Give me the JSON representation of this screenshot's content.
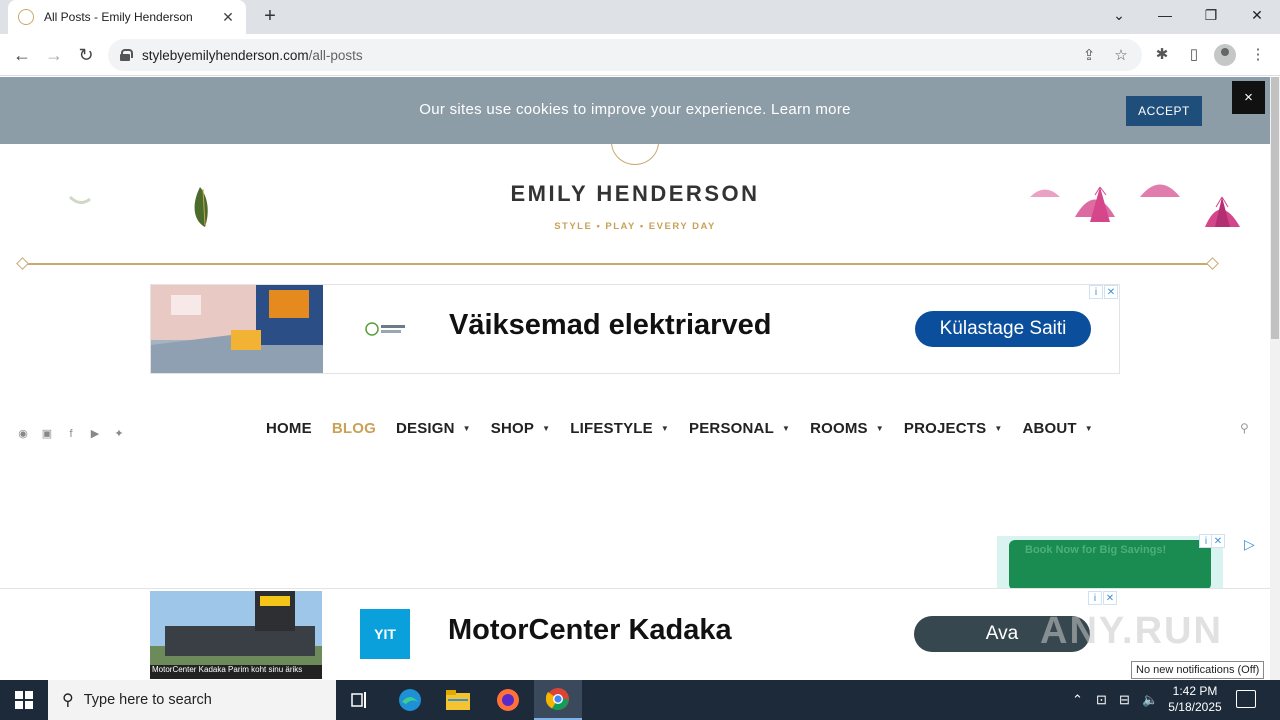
{
  "browser": {
    "tab_title": "All Posts - Emily Henderson",
    "new_tab": "+",
    "url_host": "stylebyemilyhenderson.com",
    "url_path": "/all-posts"
  },
  "cookie_banner": {
    "text": "Our sites use cookies to improve your experience. Learn more",
    "accept_label": "ACCEPT",
    "close_label": "×"
  },
  "site": {
    "brand": "EMILY HENDERSON",
    "tagline": "STYLE  •  PLAY  •  EVERY DAY"
  },
  "ad_top": {
    "headline": "Väiksemad elektriarved",
    "cta": "Külastage Saiti",
    "cta_color": "#0b4f9c"
  },
  "nav": {
    "items": [
      {
        "label": "HOME",
        "has_caret": false
      },
      {
        "label": "BLOG",
        "has_caret": false,
        "active": true
      },
      {
        "label": "DESIGN",
        "has_caret": true
      },
      {
        "label": "SHOP",
        "has_caret": true
      },
      {
        "label": "LIFESTYLE",
        "has_caret": true
      },
      {
        "label": "PERSONAL",
        "has_caret": true
      },
      {
        "label": "ROOMS",
        "has_caret": true
      },
      {
        "label": "PROJECTS",
        "has_caret": true
      },
      {
        "label": "ABOUT",
        "has_caret": true
      }
    ],
    "active_color": "#c8a258"
  },
  "side_ad": {
    "text": "Book Now for Big Savings!"
  },
  "ad_bottom": {
    "image_caption": "MotorCenter Kadaka  Parim koht sinu äriks",
    "logo_text": "YIT",
    "headline": "MotorCenter Kadaka",
    "cta": "Ava",
    "cta_color": "#37474f"
  },
  "watermark": "ANY.RUN",
  "notification_tooltip": "No new notifications (Off)",
  "taskbar": {
    "search_placeholder": "Type here to search",
    "time": "1:42 PM",
    "date": "5/18/2025"
  }
}
